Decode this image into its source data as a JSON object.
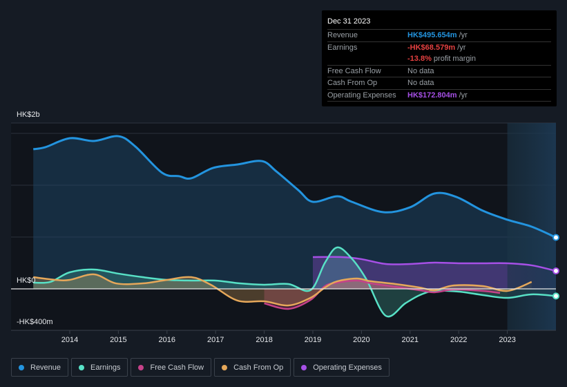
{
  "tooltip": {
    "date": "Dec 31 2023",
    "rows": [
      {
        "label": "Revenue",
        "value": "HK$495.654m",
        "suffix": " /yr",
        "color": "#2394df"
      },
      {
        "label": "Earnings",
        "value": "-HK$68.579m",
        "suffix": " /yr",
        "color": "#e64141"
      },
      {
        "label": "",
        "value": "-13.8%",
        "suffix": " profit margin",
        "color": "#e64141"
      },
      {
        "label": "Free Cash Flow",
        "value": "",
        "suffix": "No data",
        "color": "#9aa0a6"
      },
      {
        "label": "Cash From Op",
        "value": "",
        "suffix": "No data",
        "color": "#9aa0a6"
      },
      {
        "label": "Operating Expenses",
        "value": "HK$172.804m",
        "suffix": " /yr",
        "color": "#a650e6"
      }
    ]
  },
  "legend": [
    {
      "label": "Revenue",
      "color": "#2394df"
    },
    {
      "label": "Earnings",
      "color": "#58e1c6"
    },
    {
      "label": "Free Cash Flow",
      "color": "#c54289"
    },
    {
      "label": "Cash From Op",
      "color": "#e6a85a"
    },
    {
      "label": "Operating Expenses",
      "color": "#a650e6"
    }
  ],
  "chart_data": {
    "type": "area",
    "title": "",
    "xlabel": "",
    "ylabel": "",
    "y_unit": "HK$ millions",
    "y_tick_labels": [
      "HK$2b",
      "HK$0",
      "-HK$400m"
    ],
    "ylim": [
      -400,
      1600
    ],
    "xlim": [
      2012.3,
      2024.0
    ],
    "x_ticks": [
      2014,
      2015,
      2016,
      2017,
      2018,
      2019,
      2020,
      2021,
      2022,
      2023
    ],
    "highlight_range": [
      2023.0,
      2024.0
    ],
    "grid": true,
    "legend_position": "bottom-left",
    "series": [
      {
        "name": "Revenue",
        "color": "#2394df",
        "points": [
          [
            2013.25,
            1347
          ],
          [
            2013.5,
            1367
          ],
          [
            2014.0,
            1453
          ],
          [
            2014.5,
            1427
          ],
          [
            2015.0,
            1473
          ],
          [
            2015.35,
            1373
          ],
          [
            2015.9,
            1120
          ],
          [
            2016.25,
            1087
          ],
          [
            2016.5,
            1067
          ],
          [
            2016.95,
            1167
          ],
          [
            2017.45,
            1200
          ],
          [
            2017.95,
            1233
          ],
          [
            2018.25,
            1133
          ],
          [
            2018.7,
            953
          ],
          [
            2019.0,
            840
          ],
          [
            2019.5,
            893
          ],
          [
            2019.8,
            840
          ],
          [
            2020.45,
            740
          ],
          [
            2021.0,
            787
          ],
          [
            2021.5,
            920
          ],
          [
            2021.95,
            887
          ],
          [
            2022.5,
            753
          ],
          [
            2023.0,
            667
          ],
          [
            2023.5,
            600
          ],
          [
            2024.0,
            496
          ]
        ]
      },
      {
        "name": "Earnings",
        "color": "#58e1c6",
        "points": [
          [
            2013.25,
            60
          ],
          [
            2013.6,
            67
          ],
          [
            2014.0,
            160
          ],
          [
            2014.5,
            187
          ],
          [
            2015.0,
            147
          ],
          [
            2015.5,
            113
          ],
          [
            2016.0,
            87
          ],
          [
            2016.5,
            80
          ],
          [
            2017.0,
            80
          ],
          [
            2017.5,
            53
          ],
          [
            2018.0,
            40
          ],
          [
            2018.5,
            47
          ],
          [
            2018.95,
            -13
          ],
          [
            2019.25,
            253
          ],
          [
            2019.5,
            400
          ],
          [
            2019.8,
            293
          ],
          [
            2020.1,
            93
          ],
          [
            2020.5,
            -260
          ],
          [
            2020.9,
            -140
          ],
          [
            2021.2,
            -60
          ],
          [
            2021.5,
            -20
          ],
          [
            2022.0,
            -27
          ],
          [
            2022.5,
            -60
          ],
          [
            2023.0,
            -87
          ],
          [
            2023.5,
            -53
          ],
          [
            2024.0,
            -69
          ]
        ]
      },
      {
        "name": "Free Cash Flow",
        "color": "#c54289",
        "points": [
          [
            2018.0,
            -140
          ],
          [
            2018.5,
            -193
          ],
          [
            2018.95,
            -107
          ],
          [
            2019.25,
            27
          ],
          [
            2019.5,
            60
          ],
          [
            2019.9,
            80
          ],
          [
            2020.2,
            53
          ],
          [
            2020.7,
            20
          ],
          [
            2021.2,
            -13
          ],
          [
            2021.5,
            -33
          ],
          [
            2021.9,
            -7
          ],
          [
            2022.5,
            -20
          ],
          [
            2022.85,
            -40
          ]
        ]
      },
      {
        "name": "Cash From Op",
        "color": "#e6a85a",
        "points": [
          [
            2013.25,
            113
          ],
          [
            2013.7,
            87
          ],
          [
            2014.0,
            87
          ],
          [
            2014.5,
            140
          ],
          [
            2014.95,
            53
          ],
          [
            2015.5,
            53
          ],
          [
            2016.0,
            87
          ],
          [
            2016.5,
            113
          ],
          [
            2016.9,
            40
          ],
          [
            2017.45,
            -113
          ],
          [
            2018.0,
            -120
          ],
          [
            2018.5,
            -160
          ],
          [
            2018.95,
            -87
          ],
          [
            2019.25,
            13
          ],
          [
            2019.5,
            73
          ],
          [
            2019.9,
            100
          ],
          [
            2020.2,
            73
          ],
          [
            2020.7,
            47
          ],
          [
            2021.2,
            13
          ],
          [
            2021.5,
            -13
          ],
          [
            2021.9,
            33
          ],
          [
            2022.5,
            27
          ],
          [
            2023.0,
            -20
          ],
          [
            2023.5,
            67
          ]
        ]
      },
      {
        "name": "Operating Expenses",
        "color": "#a650e6",
        "points": [
          [
            2019.0,
            307
          ],
          [
            2019.6,
            307
          ],
          [
            2020.0,
            287
          ],
          [
            2020.5,
            240
          ],
          [
            2021.0,
            240
          ],
          [
            2021.5,
            253
          ],
          [
            2022.0,
            247
          ],
          [
            2022.5,
            247
          ],
          [
            2023.0,
            247
          ],
          [
            2023.5,
            227
          ],
          [
            2024.0,
            173
          ]
        ]
      }
    ]
  }
}
